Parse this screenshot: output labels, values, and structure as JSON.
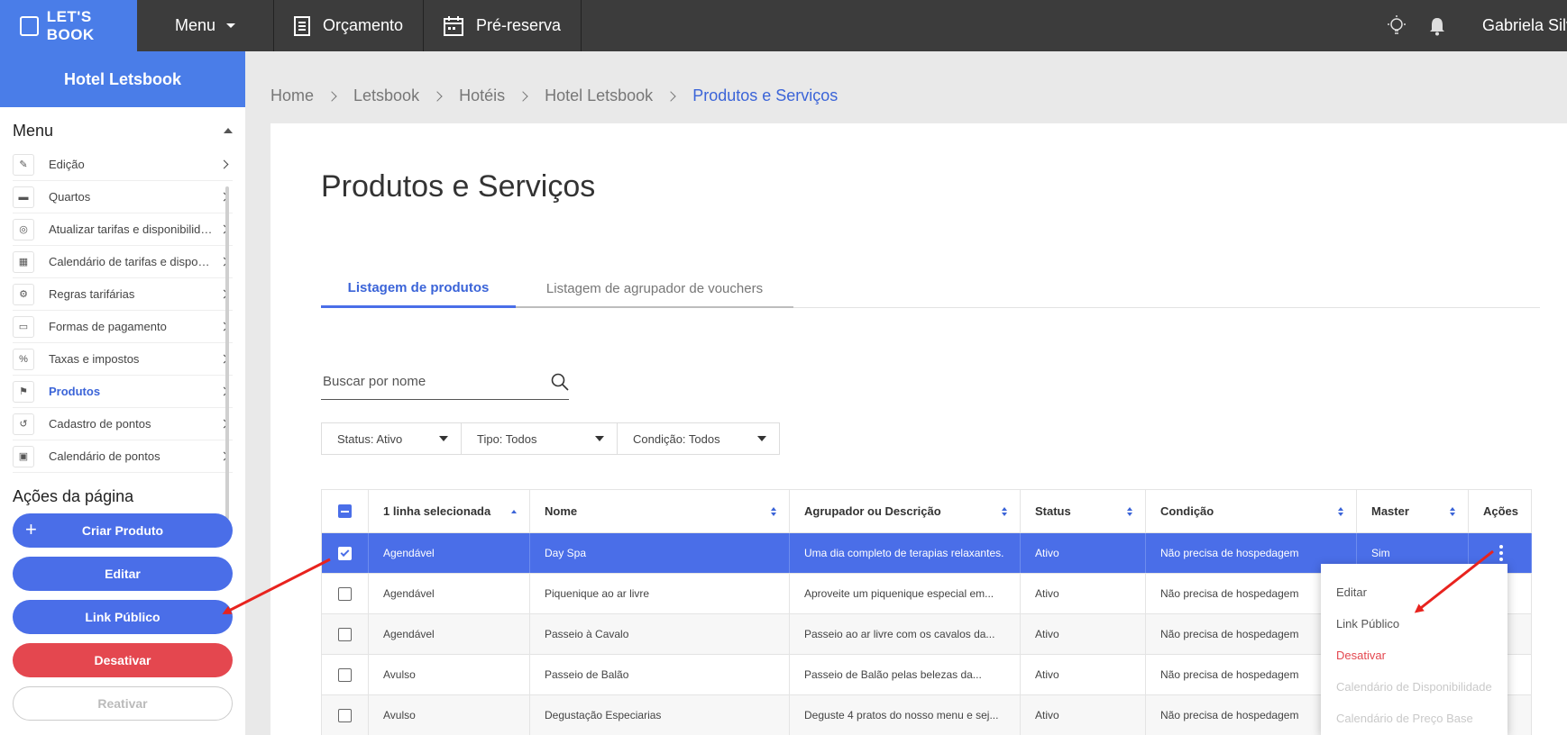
{
  "topbar": {
    "brand": "LET'S BOOK",
    "menu_label": "Menu",
    "nav": [
      {
        "label": "Orçamento",
        "icon": "document-icon"
      },
      {
        "label": "Pré-reserva",
        "icon": "calendar-icon"
      }
    ],
    "user_name": "Gabriela Silveira"
  },
  "sidebar": {
    "hotel_name": "Hotel Letsbook",
    "menu_title": "Menu",
    "items": [
      {
        "label": "Edição",
        "icon": "✎"
      },
      {
        "label": "Quartos",
        "icon": "▬"
      },
      {
        "label": "Atualizar tarifas e disponibilidade",
        "icon": "◎"
      },
      {
        "label": "Calendário de tarifas e disponibilidade",
        "icon": "▦"
      },
      {
        "label": "Regras tarifárias",
        "icon": "⚙"
      },
      {
        "label": "Formas de pagamento",
        "icon": "▭"
      },
      {
        "label": "Taxas e impostos",
        "icon": "%"
      },
      {
        "label": "Produtos",
        "icon": "⚑"
      },
      {
        "label": "Cadastro de pontos",
        "icon": "↺"
      },
      {
        "label": "Calendário de pontos",
        "icon": "▣"
      }
    ],
    "page_actions_title": "Ações da página",
    "actions": {
      "create": "Criar Produto",
      "edit": "Editar",
      "public_link": "Link Público",
      "deactivate": "Desativar",
      "reactivate": "Reativar"
    }
  },
  "breadcrumb": [
    "Home",
    "Letsbook",
    "Hotéis",
    "Hotel Letsbook",
    "Produtos e Serviços"
  ],
  "page_title": "Produtos e Serviços",
  "tabs": [
    "Listagem de produtos",
    "Listagem de agrupador de vouchers"
  ],
  "search": {
    "placeholder": "Buscar por nome"
  },
  "filters": [
    "Status: Ativo",
    "Tipo: Todos",
    "Condição: Todos"
  ],
  "table": {
    "headers": [
      "1 linha selecionada",
      "Nome",
      "Agrupador ou Descrição",
      "Status",
      "Condição",
      "Master",
      "Ações"
    ],
    "rows": [
      {
        "tipo": "Agendável",
        "nome": "Day Spa",
        "desc": "Uma dia completo de terapias relaxantes.",
        "status": "Ativo",
        "cond": "Não precisa de hospedagem",
        "master": "Sim"
      },
      {
        "tipo": "Agendável",
        "nome": "Piquenique ao ar livre",
        "desc": "Aproveite um piquenique especial em...",
        "status": "Ativo",
        "cond": "Não precisa de hospedagem",
        "master": ""
      },
      {
        "tipo": "Agendável",
        "nome": "Passeio à Cavalo",
        "desc": "Passeio ao ar livre com os cavalos da...",
        "status": "Ativo",
        "cond": "Não precisa de hospedagem",
        "master": ""
      },
      {
        "tipo": "Avulso",
        "nome": "Passeio de Balão",
        "desc": "Passeio de Balão pelas belezas da...",
        "status": "Ativo",
        "cond": "Não precisa de hospedagem",
        "master": ""
      },
      {
        "tipo": "Avulso",
        "nome": "Degustação Especiarias",
        "desc": "Deguste 4 pratos do nosso menu e sej...",
        "status": "Ativo",
        "cond": "Não precisa de hospedagem",
        "master": ""
      }
    ]
  },
  "dropdown": [
    "Editar",
    "Link Público",
    "Desativar",
    "Calendário de Disponibilidade",
    "Calendário de Preço Base"
  ],
  "colors": {
    "accent": "#4a6ee8",
    "danger": "#e4474f",
    "topbar": "#3c3c3c",
    "annotation_arrow": "#e8231e"
  }
}
